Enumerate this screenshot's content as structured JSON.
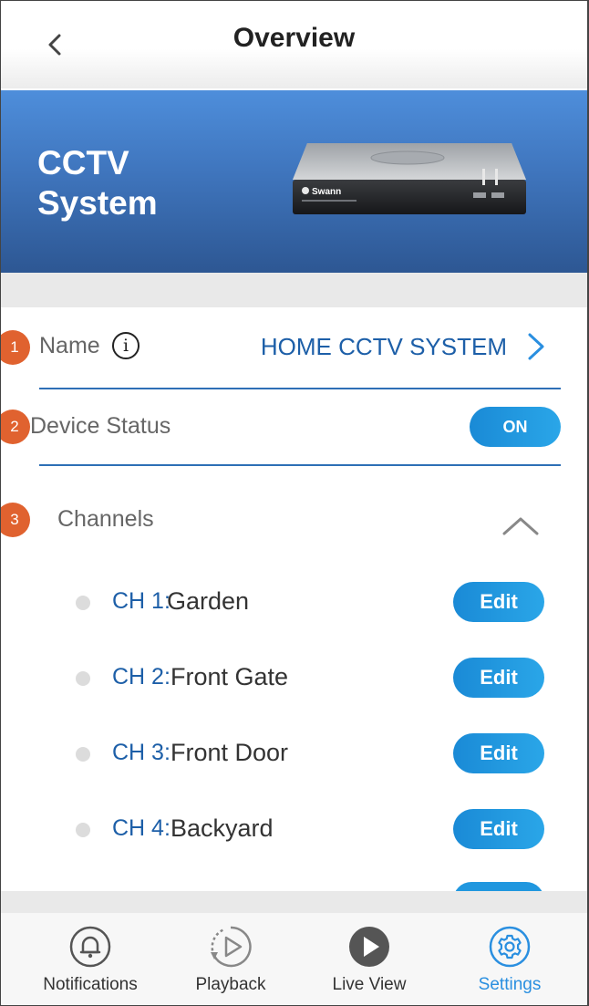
{
  "header": {
    "title": "Overview"
  },
  "hero": {
    "title_line1": "CCTV",
    "title_line2": "System",
    "device_brand": "Swann"
  },
  "annotations": [
    "1",
    "2",
    "3"
  ],
  "name_row": {
    "label": "Name",
    "info_icon": "i",
    "value": "HOME CCTV SYSTEM"
  },
  "status_row": {
    "label": "Device Status",
    "toggle": "ON"
  },
  "channels": {
    "label": "Channels",
    "items": [
      {
        "id": "CH 1:",
        "name": "Garden",
        "edit": "Edit"
      },
      {
        "id": "CH 2:",
        "name": "Front Gate",
        "edit": "Edit"
      },
      {
        "id": "CH 3:",
        "name": "Front Door",
        "edit": "Edit"
      },
      {
        "id": "CH 4:",
        "name": "Backyard",
        "edit": "Edit"
      }
    ]
  },
  "tabs": [
    {
      "label": "Notifications",
      "icon": "bell-icon"
    },
    {
      "label": "Playback",
      "icon": "playback-icon"
    },
    {
      "label": "Live View",
      "icon": "play-icon"
    },
    {
      "label": "Settings",
      "icon": "gear-icon",
      "active": true
    }
  ],
  "colors": {
    "accent": "#1d5fa8",
    "toggle": "#2097df",
    "badge": "#e0622f",
    "hero": "#3f75bd"
  }
}
